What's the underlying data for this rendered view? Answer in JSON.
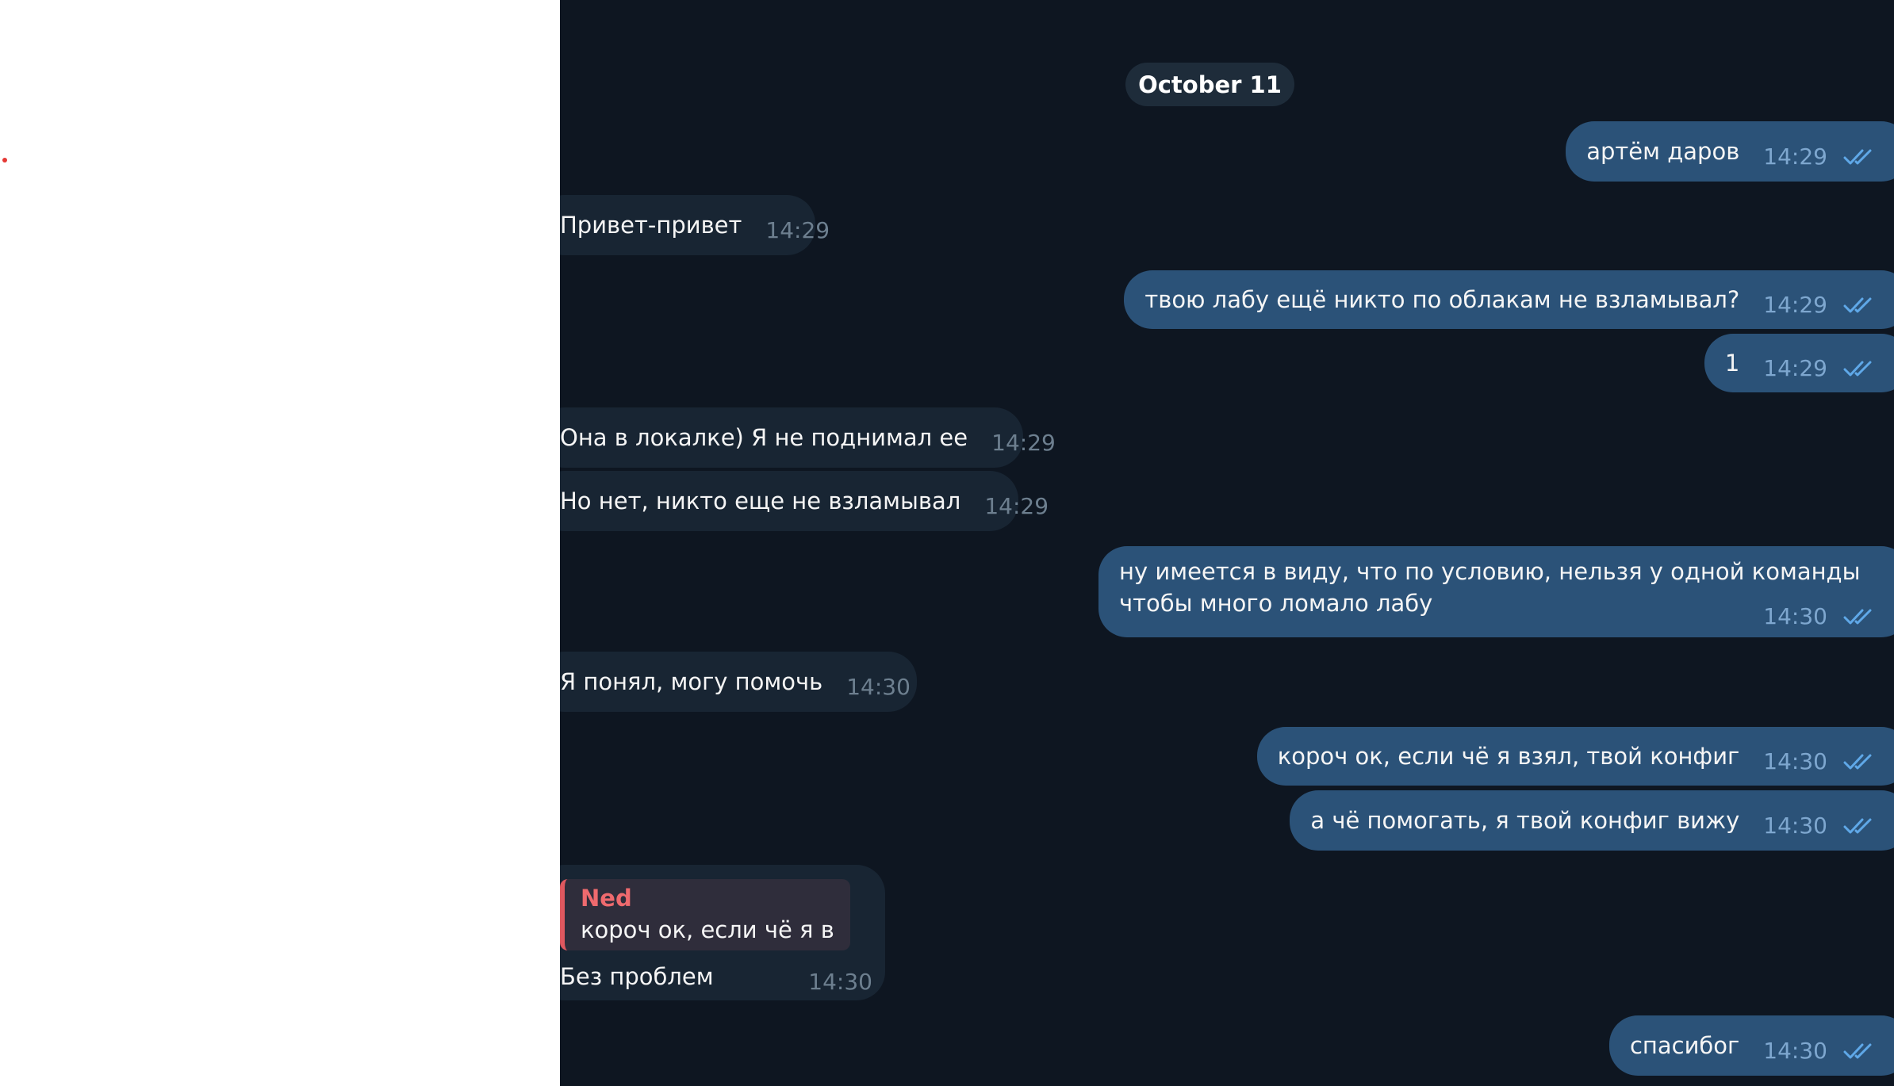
{
  "chat": {
    "date_separator": "October 11",
    "messages": [
      {
        "direction": "out",
        "text": "артём даров",
        "time": "14:29",
        "read": true
      },
      {
        "direction": "in",
        "text": "Привет-привет",
        "time": "14:29"
      },
      {
        "direction": "out",
        "text": "твою лабу ещё никто по облакам не взламывал?",
        "time": "14:29",
        "read": true
      },
      {
        "direction": "out",
        "text": "1",
        "time": "14:29",
        "read": true
      },
      {
        "direction": "in",
        "text": "Она в локалке) Я не поднимал ее",
        "time": "14:29"
      },
      {
        "direction": "in",
        "text": "Но нет, никто еще не взламывал",
        "time": "14:29"
      },
      {
        "direction": "out",
        "text_line1": "ну имеется в виду, что по условию, нельзя у одной команды",
        "text_line2": "чтобы много ломало лабу",
        "time": "14:30",
        "read": true
      },
      {
        "direction": "in",
        "text": "Я понял, могу помочь",
        "time": "14:30"
      },
      {
        "direction": "out",
        "text": "короч ок, если чё я взял, твой конфиг",
        "time": "14:30",
        "read": true
      },
      {
        "direction": "out",
        "text": "а чё помогать, я твой конфиг вижу",
        "time": "14:30",
        "read": true
      },
      {
        "direction": "in",
        "reply_author": "Ned",
        "reply_text": "короч ок, если чё я в...",
        "text": "Без проблем",
        "time": "14:30"
      },
      {
        "direction": "out",
        "text": "спасибог",
        "time": "14:30",
        "read": true
      }
    ]
  },
  "colors": {
    "chat_background": "#0e1621",
    "incoming_bubble": "#182533",
    "outgoing_bubble": "#2b5278",
    "read_check": "#5fa8e8",
    "reply_accent": "#e0585f",
    "left_panel": "#ffffff"
  },
  "icons": {
    "read_status": "double-check-icon"
  }
}
